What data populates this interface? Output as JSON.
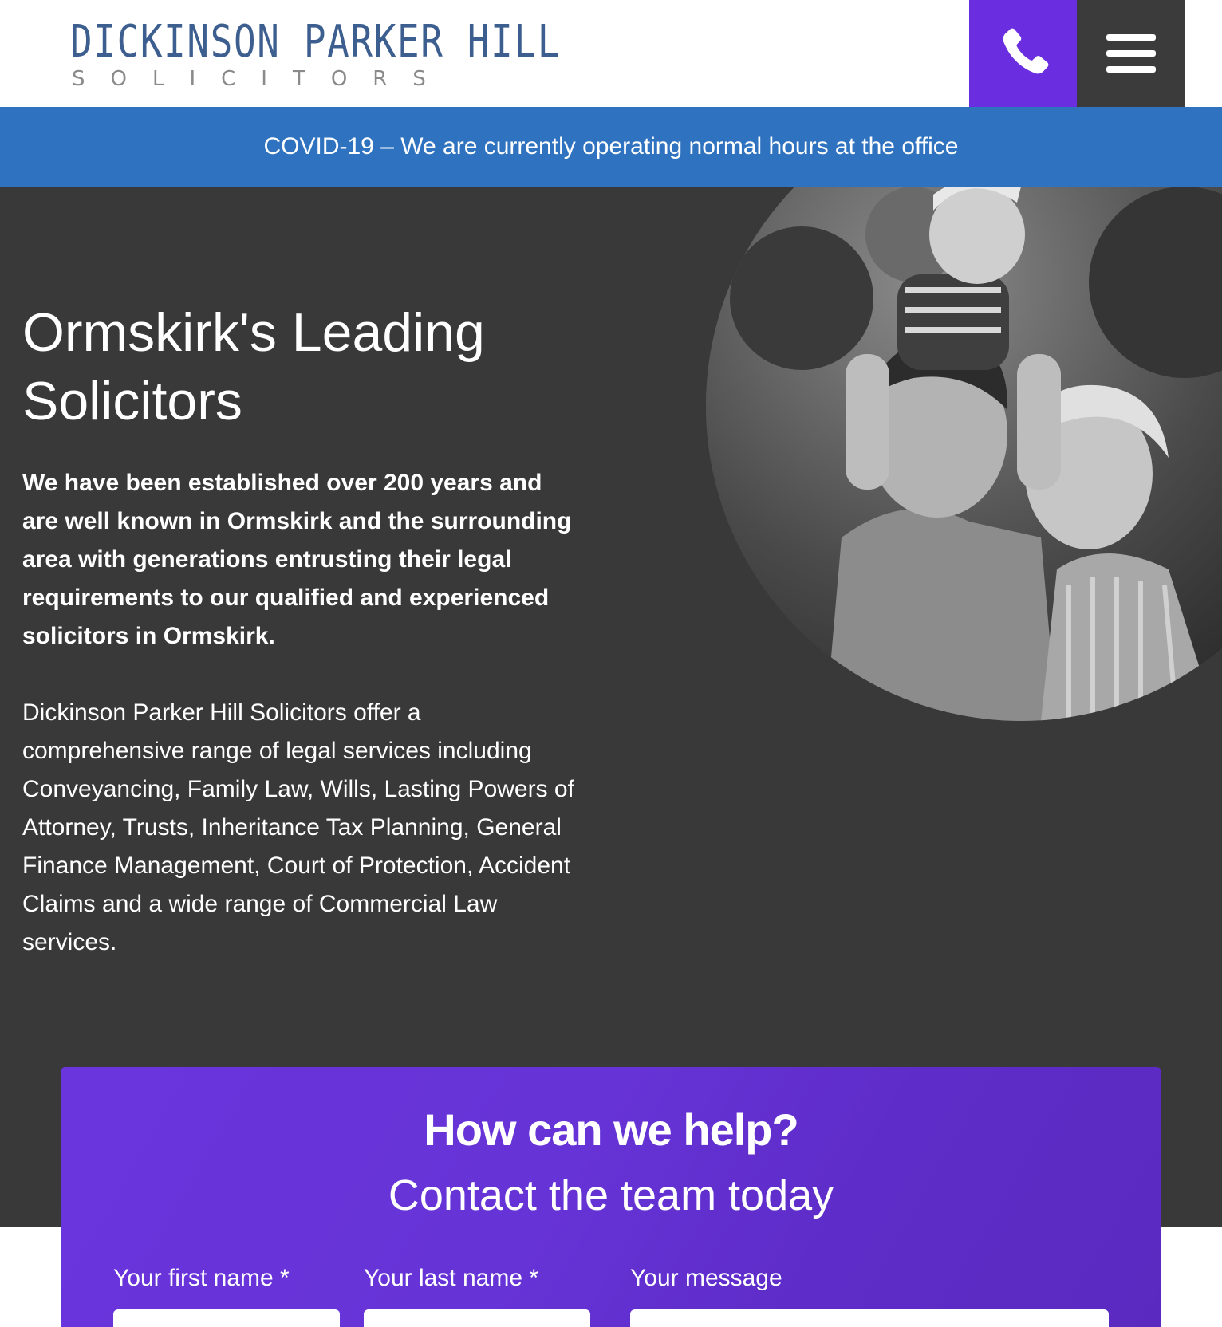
{
  "header": {
    "logo_main": "DICKINSON PARKER HILL",
    "logo_sub": "SOLICITORS",
    "phone_icon": "phone-icon",
    "menu_icon": "hamburger-menu-icon"
  },
  "notice": {
    "text": "COVID-19 – We are currently operating normal hours at the office"
  },
  "hero": {
    "title": "Ormskirk's Leading Solicitors",
    "lead": "We have been established over 200 years and are well known in Ormskirk and the surrounding area with generations entrusting their legal requirements to our qualified and experienced solicitors in Ormskirk.",
    "body": "Dickinson Parker Hill Solicitors offer a comprehensive range of legal services including Conveyancing, Family Law, Wills, Lasting Powers of Attorney, Trusts, Inheritance Tax Planning, General Finance Management, Court of Protection, Accident Claims and a wide range of Commercial Law services."
  },
  "contact": {
    "heading": "How can we help?",
    "subheading": "Contact the team today",
    "fields": {
      "first_name_label": "Your first name *",
      "last_name_label": "Your last name *",
      "message_label": "Your message"
    }
  },
  "colors": {
    "accent_purple": "#6a2ee0",
    "notice_blue": "#2f73c0",
    "hero_bg": "#393939",
    "menu_bg": "#3b3b3b",
    "logo_blue": "#3d5f8f"
  }
}
